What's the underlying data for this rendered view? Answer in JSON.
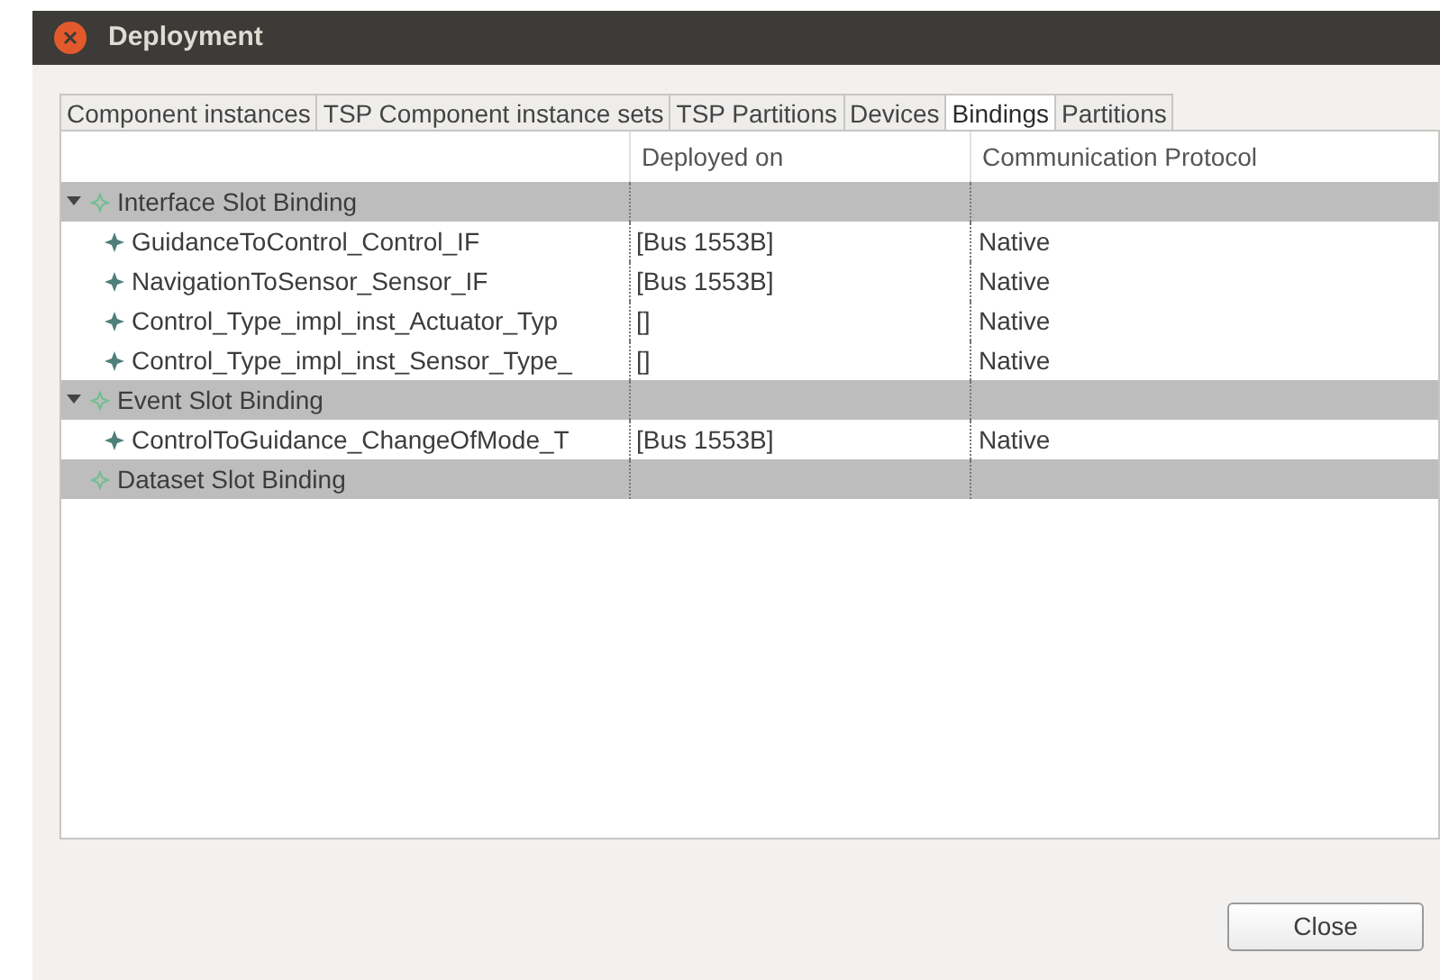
{
  "window": {
    "title": "Deployment"
  },
  "tabs": [
    {
      "label": "Component instances",
      "selected": false
    },
    {
      "label": "TSP Component instance sets",
      "selected": false
    },
    {
      "label": "TSP Partitions",
      "selected": false
    },
    {
      "label": "Devices",
      "selected": false
    },
    {
      "label": "Bindings",
      "selected": true
    },
    {
      "label": "Partitions",
      "selected": false
    }
  ],
  "table": {
    "columns": [
      "",
      "Deployed on",
      "Communication Protocol"
    ],
    "groups": [
      {
        "name": "Interface Slot Binding",
        "expanded": true,
        "children": [
          {
            "name": "GuidanceToControl_Control_IF",
            "deployed_on": "[Bus 1553B]",
            "protocol": "Native"
          },
          {
            "name": "NavigationToSensor_Sensor_IF",
            "deployed_on": "[Bus 1553B]",
            "protocol": "Native"
          },
          {
            "name": "Control_Type_impl_inst_Actuator_Typ",
            "deployed_on": "[]",
            "protocol": "Native"
          },
          {
            "name": "Control_Type_impl_inst_Sensor_Type_",
            "deployed_on": "[]",
            "protocol": "Native"
          }
        ]
      },
      {
        "name": "Event Slot Binding",
        "expanded": true,
        "children": [
          {
            "name": "ControlToGuidance_ChangeOfMode_T",
            "deployed_on": "[Bus 1553B]",
            "protocol": "Native"
          }
        ]
      },
      {
        "name": "Dataset Slot Binding"
      }
    ]
  },
  "buttons": [
    {
      "label": "Close"
    }
  ]
}
